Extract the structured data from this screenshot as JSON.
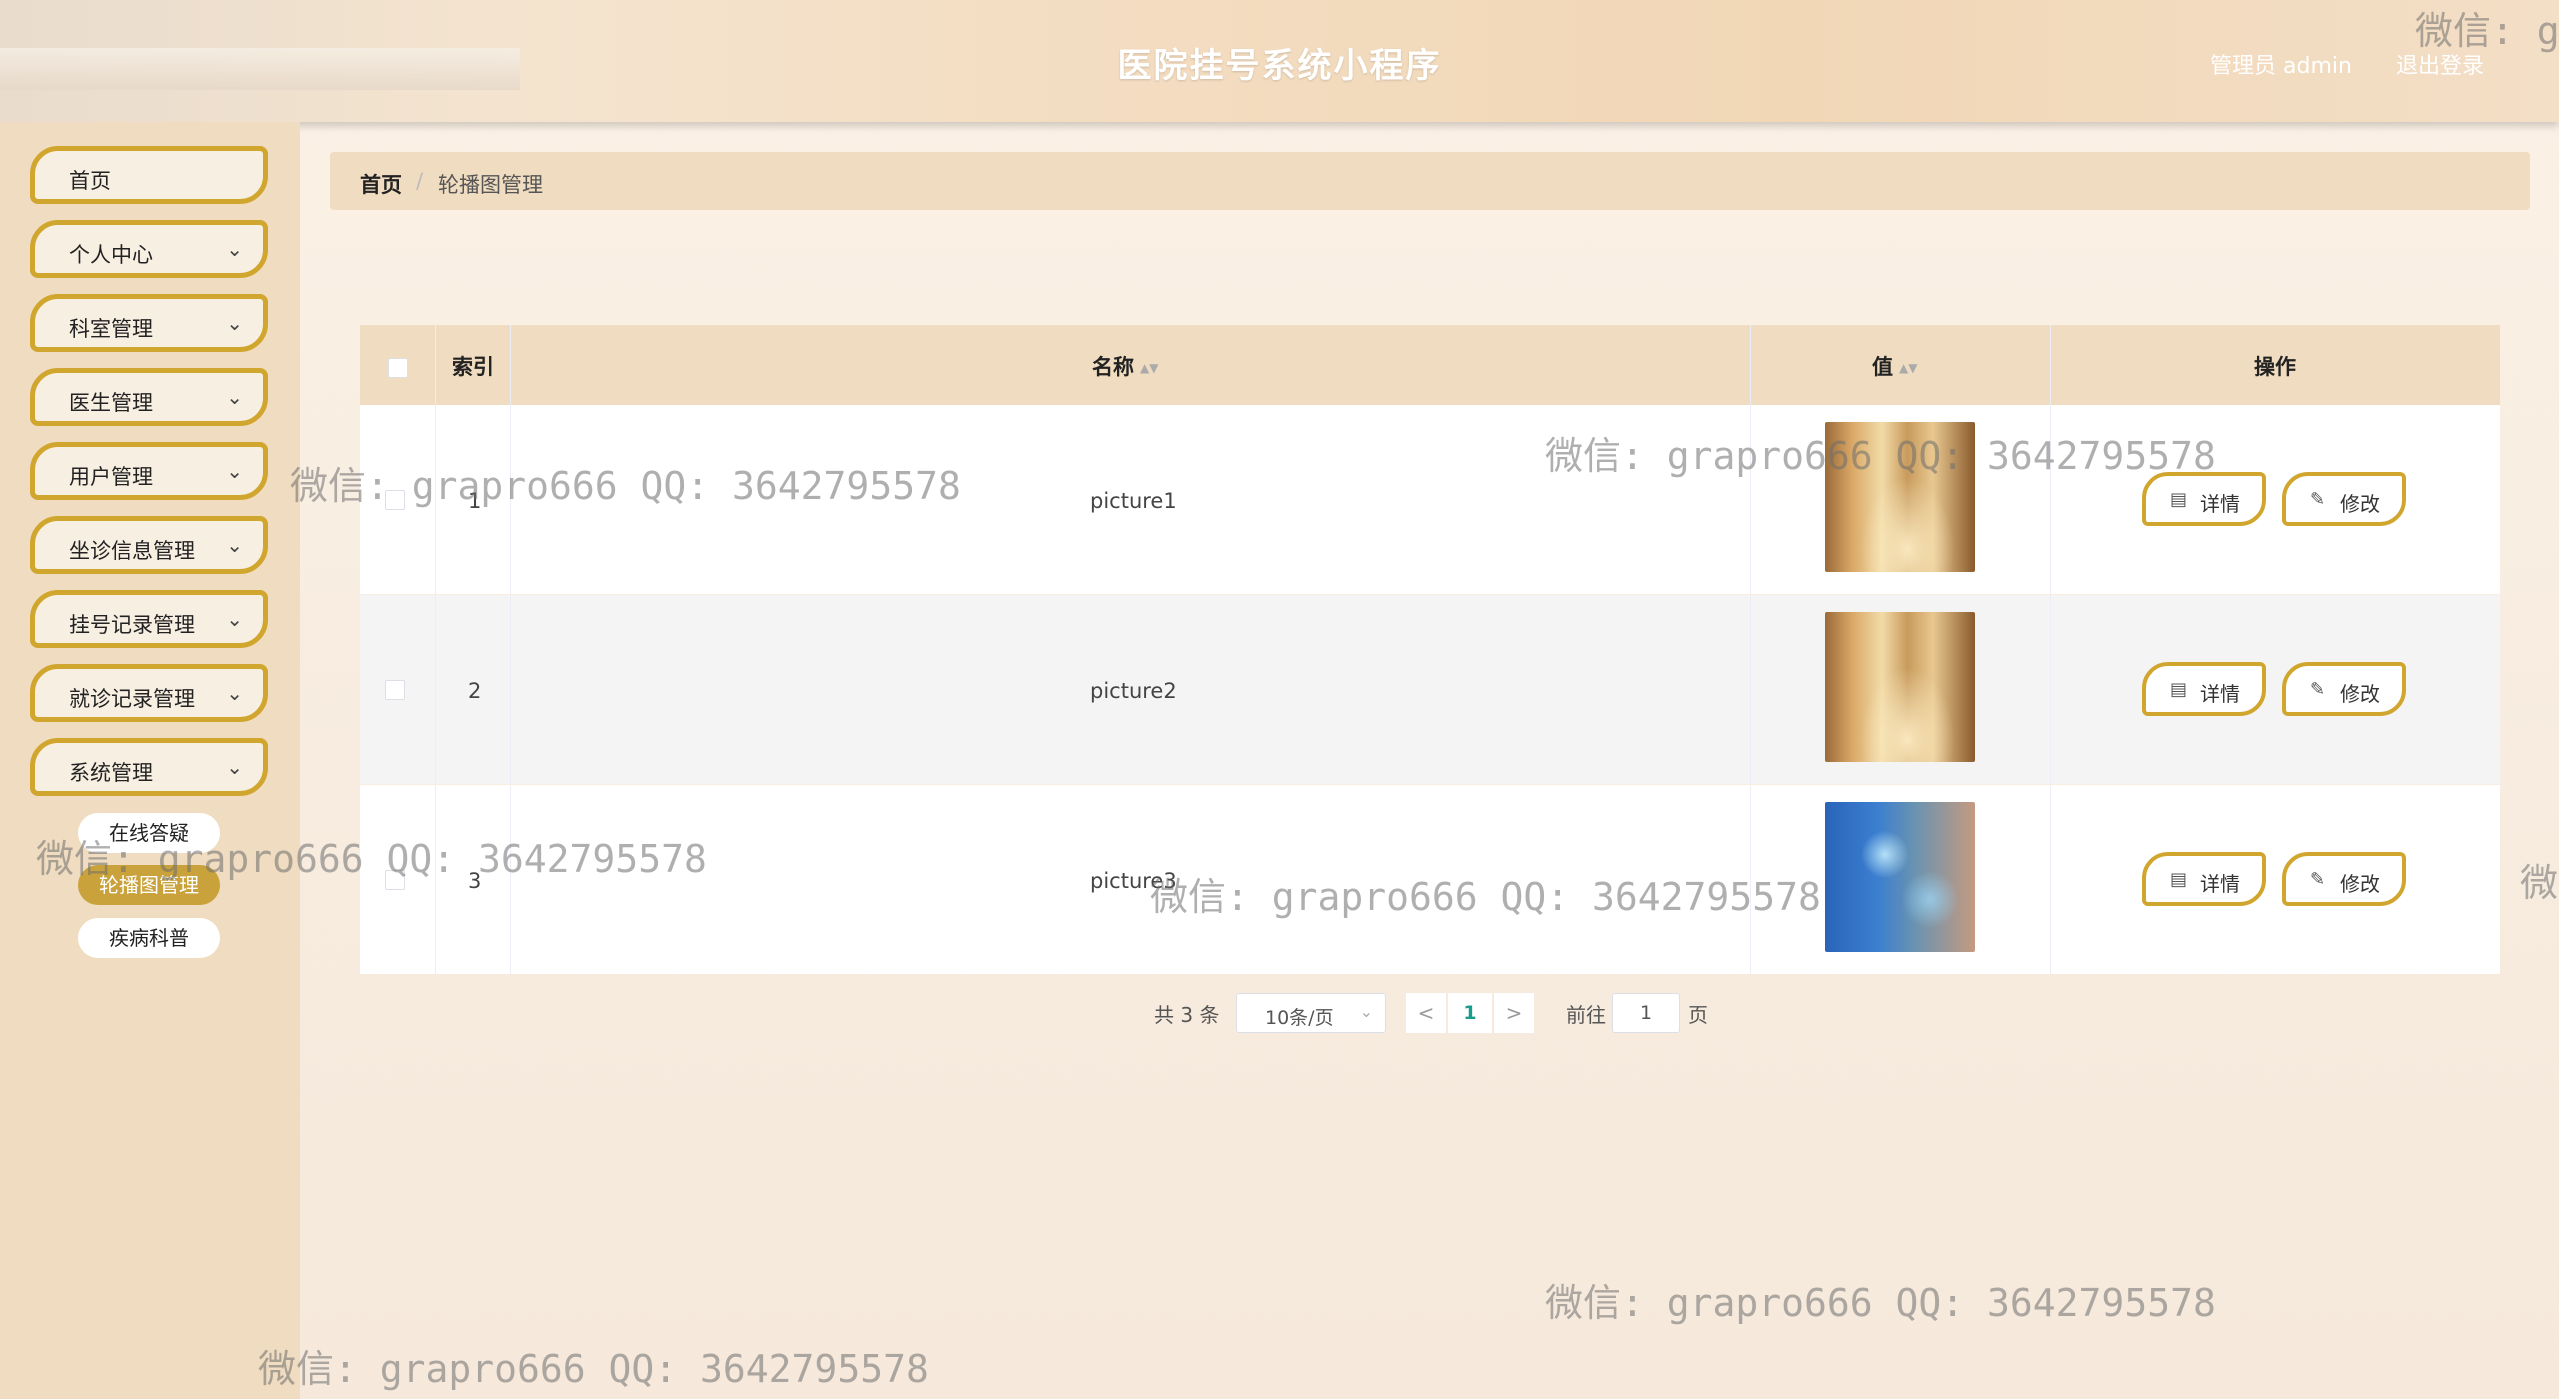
{
  "header": {
    "title": "医院挂号系统小程序",
    "admin": "管理员 admin",
    "logout": "退出登录"
  },
  "sidebar": {
    "items": [
      {
        "label": "首页",
        "has_chevron": false
      },
      {
        "label": "个人中心",
        "has_chevron": true
      },
      {
        "label": "科室管理",
        "has_chevron": true
      },
      {
        "label": "医生管理",
        "has_chevron": true
      },
      {
        "label": "用户管理",
        "has_chevron": true
      },
      {
        "label": "坐诊信息管理",
        "has_chevron": true
      },
      {
        "label": "挂号记录管理",
        "has_chevron": true
      },
      {
        "label": "就诊记录管理",
        "has_chevron": true
      },
      {
        "label": "系统管理",
        "has_chevron": true
      }
    ],
    "subitems": [
      {
        "label": "在线答疑",
        "active": false
      },
      {
        "label": "轮播图管理",
        "active": true
      },
      {
        "label": "疾病科普",
        "active": false
      }
    ]
  },
  "breadcrumb": {
    "home": "首页",
    "separator": "/",
    "current": "轮播图管理"
  },
  "table": {
    "headers": {
      "index": "索引",
      "name": "名称",
      "value": "值",
      "actions": "操作"
    },
    "rows": [
      {
        "index": "1",
        "name": "picture1",
        "image": "hospital-hall"
      },
      {
        "index": "2",
        "name": "picture2",
        "image": "hospital-hall"
      },
      {
        "index": "3",
        "name": "picture3",
        "image": "medical-tech"
      }
    ],
    "detail_label": "详情",
    "edit_label": "修改"
  },
  "pagination": {
    "total": "共 3 条",
    "page_size": "10条/页",
    "prev": "<",
    "next": ">",
    "current_page": "1",
    "goto_label": "前往",
    "goto_value": "1",
    "goto_suffix": "页"
  },
  "watermarks": {
    "full": "微信: grapro666 QQ: 3642795578",
    "edge_top": "微信: g",
    "edge_right": "微"
  },
  "colors": {
    "accent": "#d1a62f",
    "active_sub": "#c9a23b",
    "table_header": "#f0dcc0",
    "page_link": "#1a9c8a"
  }
}
